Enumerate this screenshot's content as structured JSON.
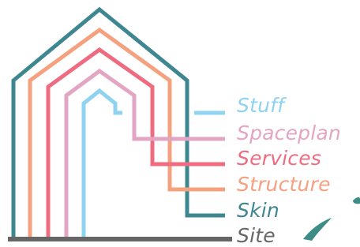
{
  "layers": [
    {
      "key": "stuff",
      "label": "Stuff",
      "color": "#8fd3f0"
    },
    {
      "key": "spaceplan",
      "label": "Spaceplan",
      "color": "#e3a5c4"
    },
    {
      "key": "services",
      "label": "Services",
      "color": "#ef6b80"
    },
    {
      "key": "structure",
      "label": "Structure",
      "color": "#f5a07f"
    },
    {
      "key": "skin",
      "label": "Skin",
      "color": "#3e8790"
    },
    {
      "key": "site",
      "label": "Site",
      "color": "#666666"
    }
  ],
  "decoration_color": "#3e8c86"
}
